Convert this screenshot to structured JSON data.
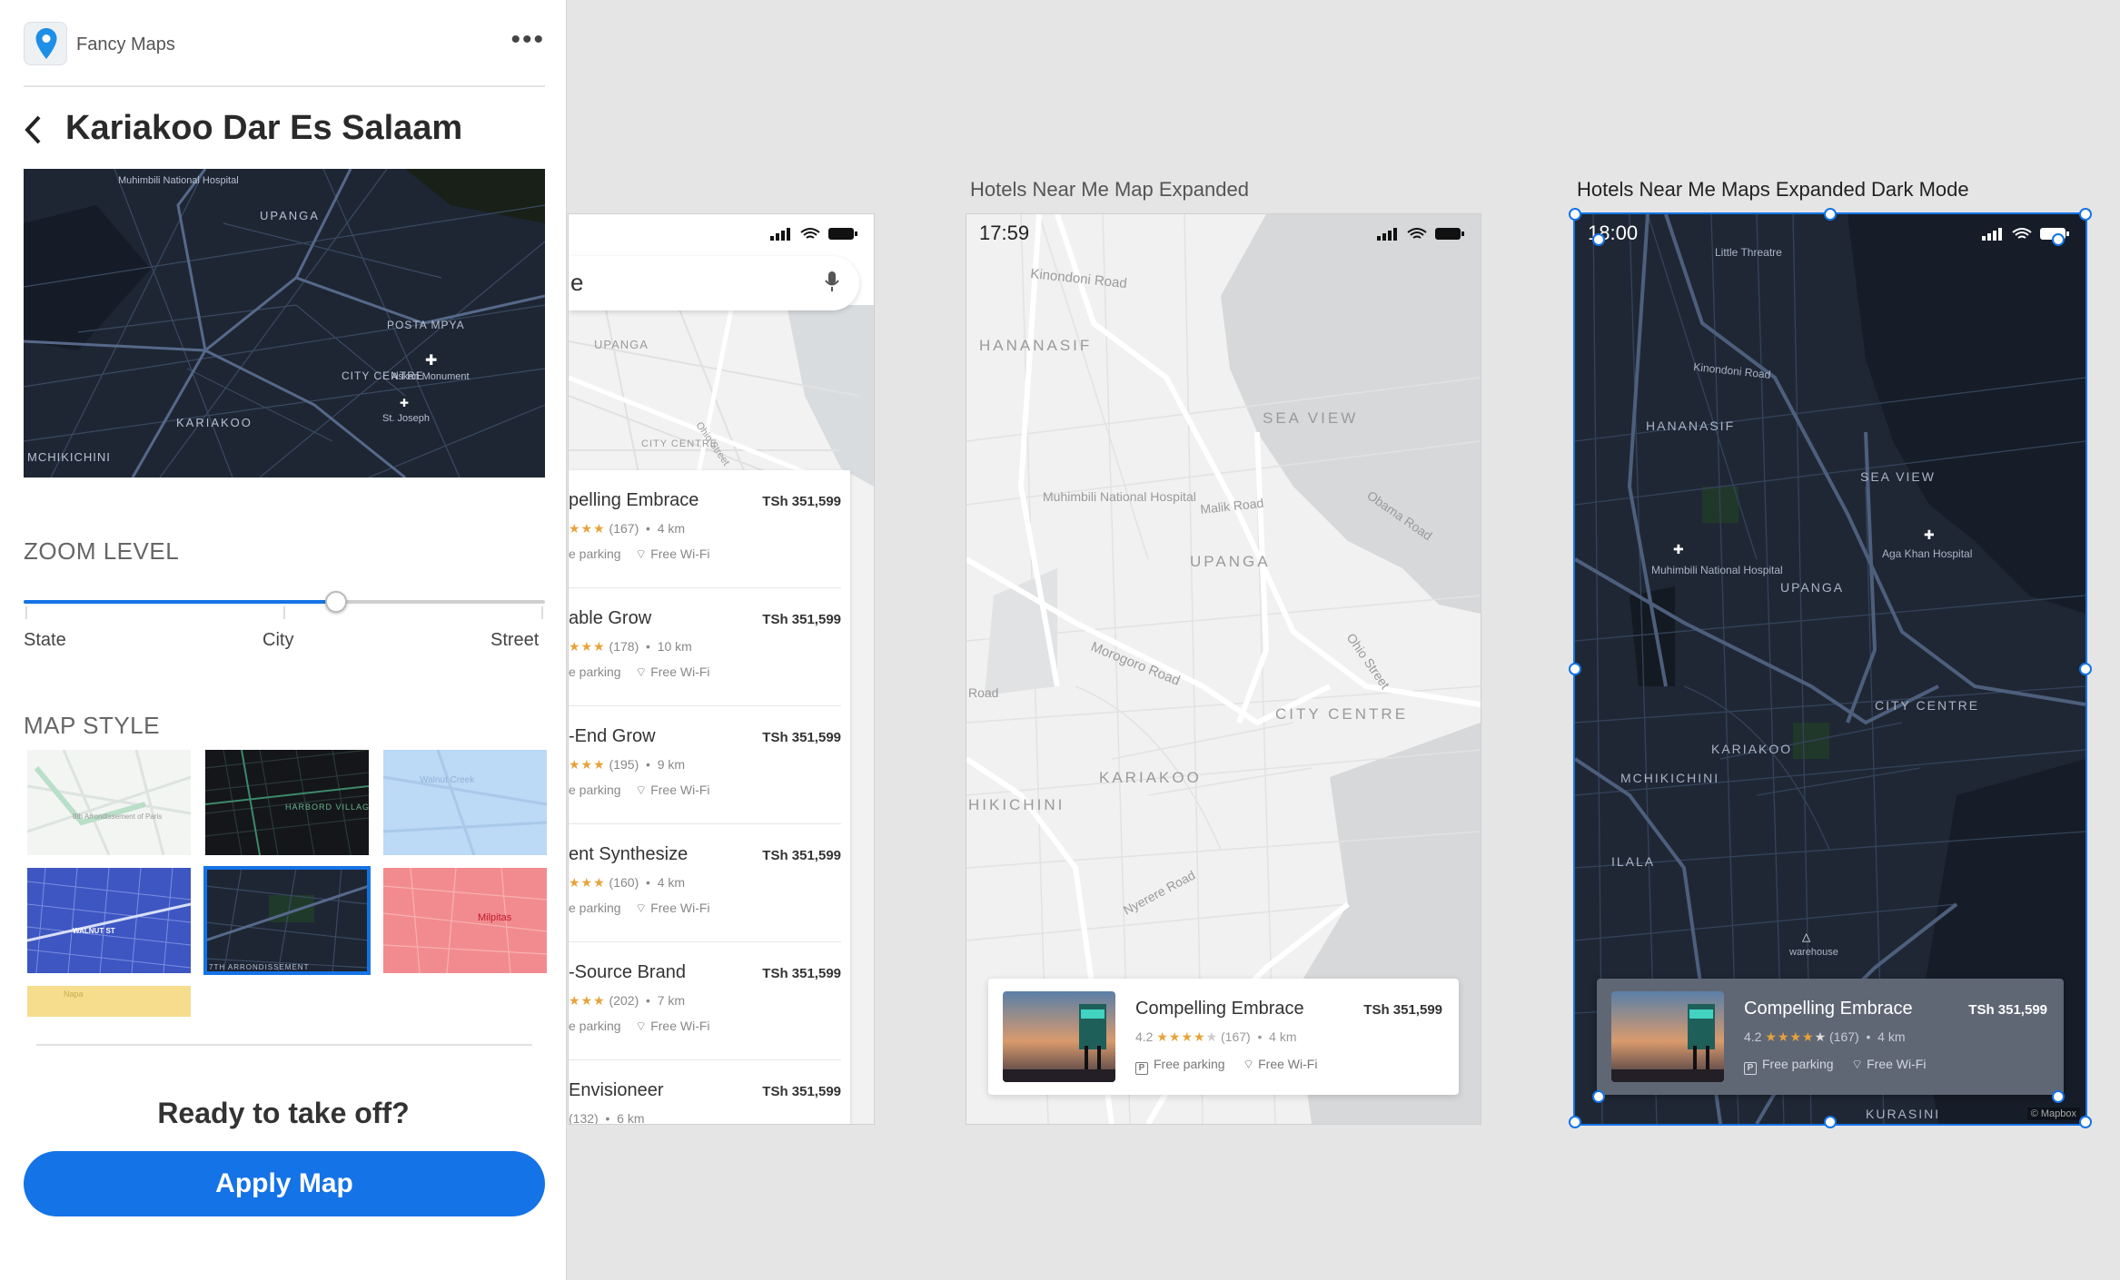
{
  "plugin": {
    "app_name": "Fancy Maps",
    "more_icon": "more-horizontal-icon",
    "back_icon": "chevron-left-icon",
    "title": "Kariakoo Dar Es Salaam",
    "preview_labels": [
      "Muhimbili National Hospital",
      "UPANGA",
      "POSTA MPYA",
      "CITY CENTRE",
      "Askari Monument",
      "St. Joseph",
      "KARIAKOO",
      "MCHIKICHINI"
    ],
    "zoom": {
      "section": "ZOOM LEVEL",
      "value": 0.6,
      "labels": [
        "State",
        "City",
        "Street"
      ]
    },
    "map_style": {
      "section": "MAP STYLE",
      "styles": [
        {
          "id": "light",
          "label": "8th Arrondissement of Paris"
        },
        {
          "id": "dark-green",
          "label": "HARBORD VILLAGE"
        },
        {
          "id": "blue-light",
          "label": "Walnut Creek"
        },
        {
          "id": "blueprint",
          "label": "WALNUT ST"
        },
        {
          "id": "dark",
          "label": "7TH ARRONDISSEMENT",
          "selected": true
        },
        {
          "id": "red",
          "label": "Milpitas"
        },
        {
          "id": "yellow",
          "label": "Napa"
        }
      ]
    },
    "ready_text": "Ready to take off?",
    "apply_label": "Apply Map",
    "accent": "#1473e6"
  },
  "artboards": {
    "list": {
      "search_text": "e",
      "map_labels": [
        "UPANGA",
        "Ohio Street",
        "CITY CENTRE"
      ],
      "items": [
        {
          "name": "pelling Embrace",
          "price": "TSh 351,599",
          "reviews": "(167)",
          "distance": "4 km",
          "parking": "e parking",
          "wifi": "Free Wi-Fi"
        },
        {
          "name": "able Grow",
          "price": "TSh 351,599",
          "reviews": "(178)",
          "distance": "10 km",
          "parking": "e parking",
          "wifi": "Free Wi-Fi"
        },
        {
          "name": "-End Grow",
          "price": "TSh 351,599",
          "reviews": "(195)",
          "distance": "9 km",
          "parking": "e parking",
          "wifi": "Free Wi-Fi"
        },
        {
          "name": "ent Synthesize",
          "price": "TSh 351,599",
          "reviews": "(160)",
          "distance": "4 km",
          "parking": "e parking",
          "wifi": "Free Wi-Fi"
        },
        {
          "name": "-Source Brand",
          "price": "TSh 351,599",
          "reviews": "(202)",
          "distance": "7 km",
          "parking": "e parking",
          "wifi": "Free Wi-Fi"
        },
        {
          "name": "Envisioneer",
          "price": "TSh 351,599",
          "reviews": "(132)",
          "distance": "6 km",
          "parking": "",
          "wifi": ""
        }
      ]
    },
    "light": {
      "title": "Hotels Near Me Map Expanded",
      "time": "17:59",
      "map_labels": [
        "Kinondoni Road",
        "HANANASIF",
        "SEA VIEW",
        "Muhimbili National Hospital",
        "Malik Road",
        "UPANGA",
        "Obama Road",
        "Morogoro Road",
        "Ohio Street",
        "CITY CENTRE",
        "KARIAKOO",
        "HIKICHINI",
        "Nyerere Road",
        "Road"
      ],
      "card": {
        "name": "Compelling Embrace",
        "price": "TSh 351,599",
        "rating": "4.2",
        "reviews": "(167)",
        "distance": "4 km",
        "parking": "Free parking",
        "wifi": "Free Wi-Fi"
      }
    },
    "dark": {
      "title": "Hotels Near Me Maps Expanded Dark Mode",
      "time": "18:00",
      "map_labels": [
        "Little Threatre",
        "Kinondoni Road",
        "HANANASIF",
        "SEA VIEW",
        "Muhimbili National Hospital",
        "Aga Khan Hospital",
        "UPANGA",
        "CITY CENTRE",
        "KARIAKOO",
        "MCHIKICHINI",
        "ILALA",
        "warehouse",
        "KURASINI"
      ],
      "card": {
        "name": "Compelling Embrace",
        "price": "TSh 351,599",
        "rating": "4.2",
        "reviews": "(167)",
        "distance": "4 km",
        "parking": "Free parking",
        "wifi": "Free Wi-Fi"
      },
      "attribution": "© Mapbox"
    }
  }
}
